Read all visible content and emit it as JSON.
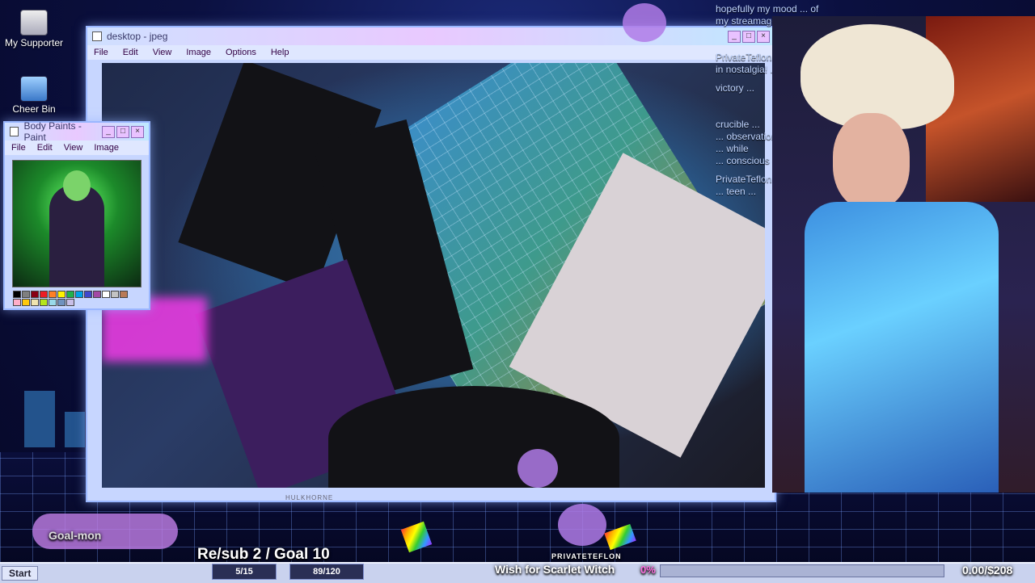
{
  "desktop": {
    "icons": [
      {
        "label": "My Supporter"
      },
      {
        "label": "Cheer Bin"
      }
    ]
  },
  "main_window": {
    "title": "desktop - jpeg",
    "menu": [
      "File",
      "Edit",
      "View",
      "Image",
      "Options",
      "Help"
    ],
    "footer_label": "HULKHORNE"
  },
  "paint_window": {
    "title": "Body Paints - Paint",
    "menu": [
      "File",
      "Edit",
      "View",
      "Image"
    ],
    "palette": [
      "#000000",
      "#7f7f7f",
      "#880015",
      "#ed1c24",
      "#ff7f27",
      "#fff200",
      "#22b14c",
      "#00a2e8",
      "#3f48cc",
      "#a349a4",
      "#ffffff",
      "#c3c3c3",
      "#b97a57",
      "#ffaec9",
      "#ffc90e",
      "#efe4b0",
      "#b5e61d",
      "#99d9ea",
      "#7092be",
      "#c8bfe7"
    ]
  },
  "chat": {
    "lines": [
      "hopefully my mood ... of",
      "my streamagotchi ...",
      "PrivateTeflon ...",
      "in nostalgia! ...",
      "victory ...",
      "crucible ...",
      "... observation ...",
      "... while",
      "... conscious -",
      "PrivateTeflon",
      "... teen ..."
    ]
  },
  "overlays": {
    "goal_monitor": "Goal-mon",
    "resub_goal": "Re/sub 2 / Goal 10",
    "stat1": "5/15",
    "stat2": "89/120",
    "wish_title": "Wish for Scarlet Witch",
    "percent": "0%",
    "money": "0.00/$208",
    "user_tag": "PRIVATETEFLON",
    "start_label": "Start"
  },
  "progress": {
    "value": 0
  },
  "colors": {
    "accent": "#ff6adf",
    "window_border": "#9ab7ff",
    "desktop_bg": "#0b1040"
  }
}
